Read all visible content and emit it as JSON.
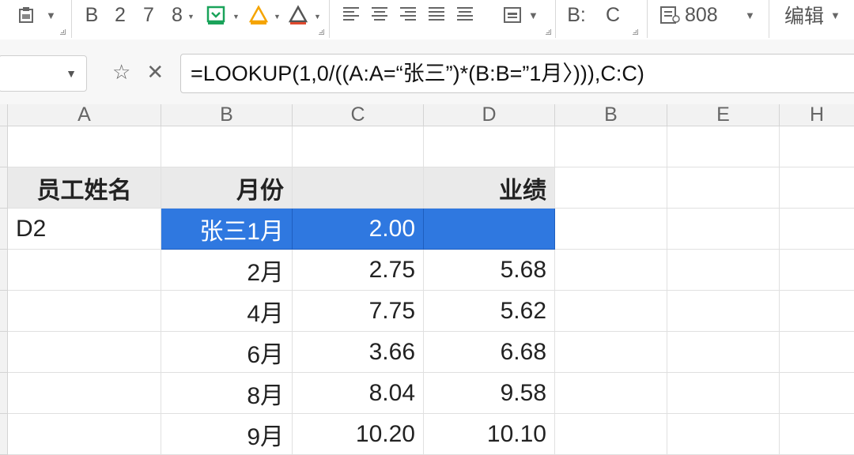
{
  "toolbar": {
    "bold": "B",
    "num2": "2",
    "num7": "7",
    "num8": "8",
    "cells_b": "B:",
    "cells_c": "C",
    "misc_label": "808",
    "edit_label": "编辑"
  },
  "formula_bar": {
    "name_box_value": "",
    "formula": "=LOOKUP(1,0/((A:A=“张三”)*(B:B=”1月〉))),C:C)"
  },
  "columns": [
    "A",
    "B",
    "C",
    "D",
    "B",
    "E",
    "H"
  ],
  "rows": [
    [
      "",
      "",
      "",
      ""
    ],
    [
      "员工姓名",
      "月份",
      "",
      "业绩"
    ],
    [
      "D2",
      "张三1月",
      "2.00",
      ""
    ],
    [
      "",
      "2月",
      "2.75",
      "5.68"
    ],
    [
      "",
      "4月",
      "7.75",
      "5.62"
    ],
    [
      "",
      "6月",
      "3.66",
      "6.68"
    ],
    [
      "",
      "8月",
      "8.04",
      "9.58"
    ],
    [
      "",
      "9月",
      "10.20",
      "10.10"
    ]
  ],
  "colors": {
    "selection": "#2f78e0",
    "accent_green": "#1aa35a",
    "accent_orange": "#f5a400",
    "accent_red": "#e04a2f"
  }
}
